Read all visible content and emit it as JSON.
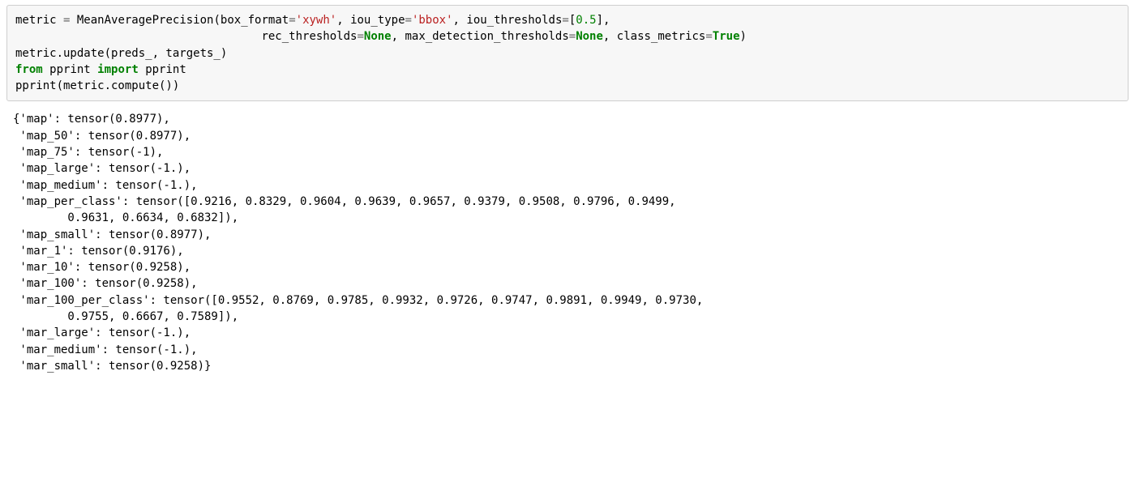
{
  "code": {
    "line1": {
      "t1": "metric ",
      "eq": "=",
      "t2": " MeanAveragePrecision",
      "lpar": "(",
      "arg1_name": "box_format",
      "arg1_eq": "=",
      "arg1_val": "'xywh'",
      "comma1": ", ",
      "arg2_name": "iou_type",
      "arg2_eq": "=",
      "arg2_val": "'bbox'",
      "comma2": ", ",
      "arg3_name": "iou_thresholds",
      "arg3_eq": "=",
      "arg3_lbr": "[",
      "arg3_val": "0.5",
      "arg3_rbr": "]",
      "comma3": ","
    },
    "line2": {
      "indent": "                                    ",
      "arg4_name": "rec_thresholds",
      "arg4_eq": "=",
      "arg4_val": "None",
      "comma4": ", ",
      "arg5_name": "max_detection_thresholds",
      "arg5_eq": "=",
      "arg5_val": "None",
      "comma5": ", ",
      "arg6_name": "class_metrics",
      "arg6_eq": "=",
      "arg6_val": "True",
      "rpar": ")"
    },
    "line3": "metric.update(preds_, targets_)",
    "line4": {
      "from": "from",
      "sp1": " ",
      "mod": "pprint",
      "sp2": " ",
      "imp": "import",
      "sp3": " ",
      "name": "pprint"
    },
    "line5": "pprint(metric.compute())"
  },
  "output": {
    "l1": "{'map': tensor(0.8977),",
    "l2": " 'map_50': tensor(0.8977),",
    "l3": " 'map_75': tensor(-1),",
    "l4": " 'map_large': tensor(-1.),",
    "l5": " 'map_medium': tensor(-1.),",
    "l6": " 'map_per_class': tensor([0.9216, 0.8329, 0.9604, 0.9639, 0.9657, 0.9379, 0.9508, 0.9796, 0.9499,",
    "l7": "        0.9631, 0.6634, 0.6832]),",
    "l8": " 'map_small': tensor(0.8977),",
    "l9": " 'mar_1': tensor(0.9176),",
    "l10": " 'mar_10': tensor(0.9258),",
    "l11": " 'mar_100': tensor(0.9258),",
    "l12": " 'mar_100_per_class': tensor([0.9552, 0.8769, 0.9785, 0.9932, 0.9726, 0.9747, 0.9891, 0.9949, 0.9730,",
    "l13": "        0.9755, 0.6667, 0.7589]),",
    "l14": " 'mar_large': tensor(-1.),",
    "l15": " 'mar_medium': tensor(-1.),",
    "l16": " 'mar_small': tensor(0.9258)}"
  }
}
